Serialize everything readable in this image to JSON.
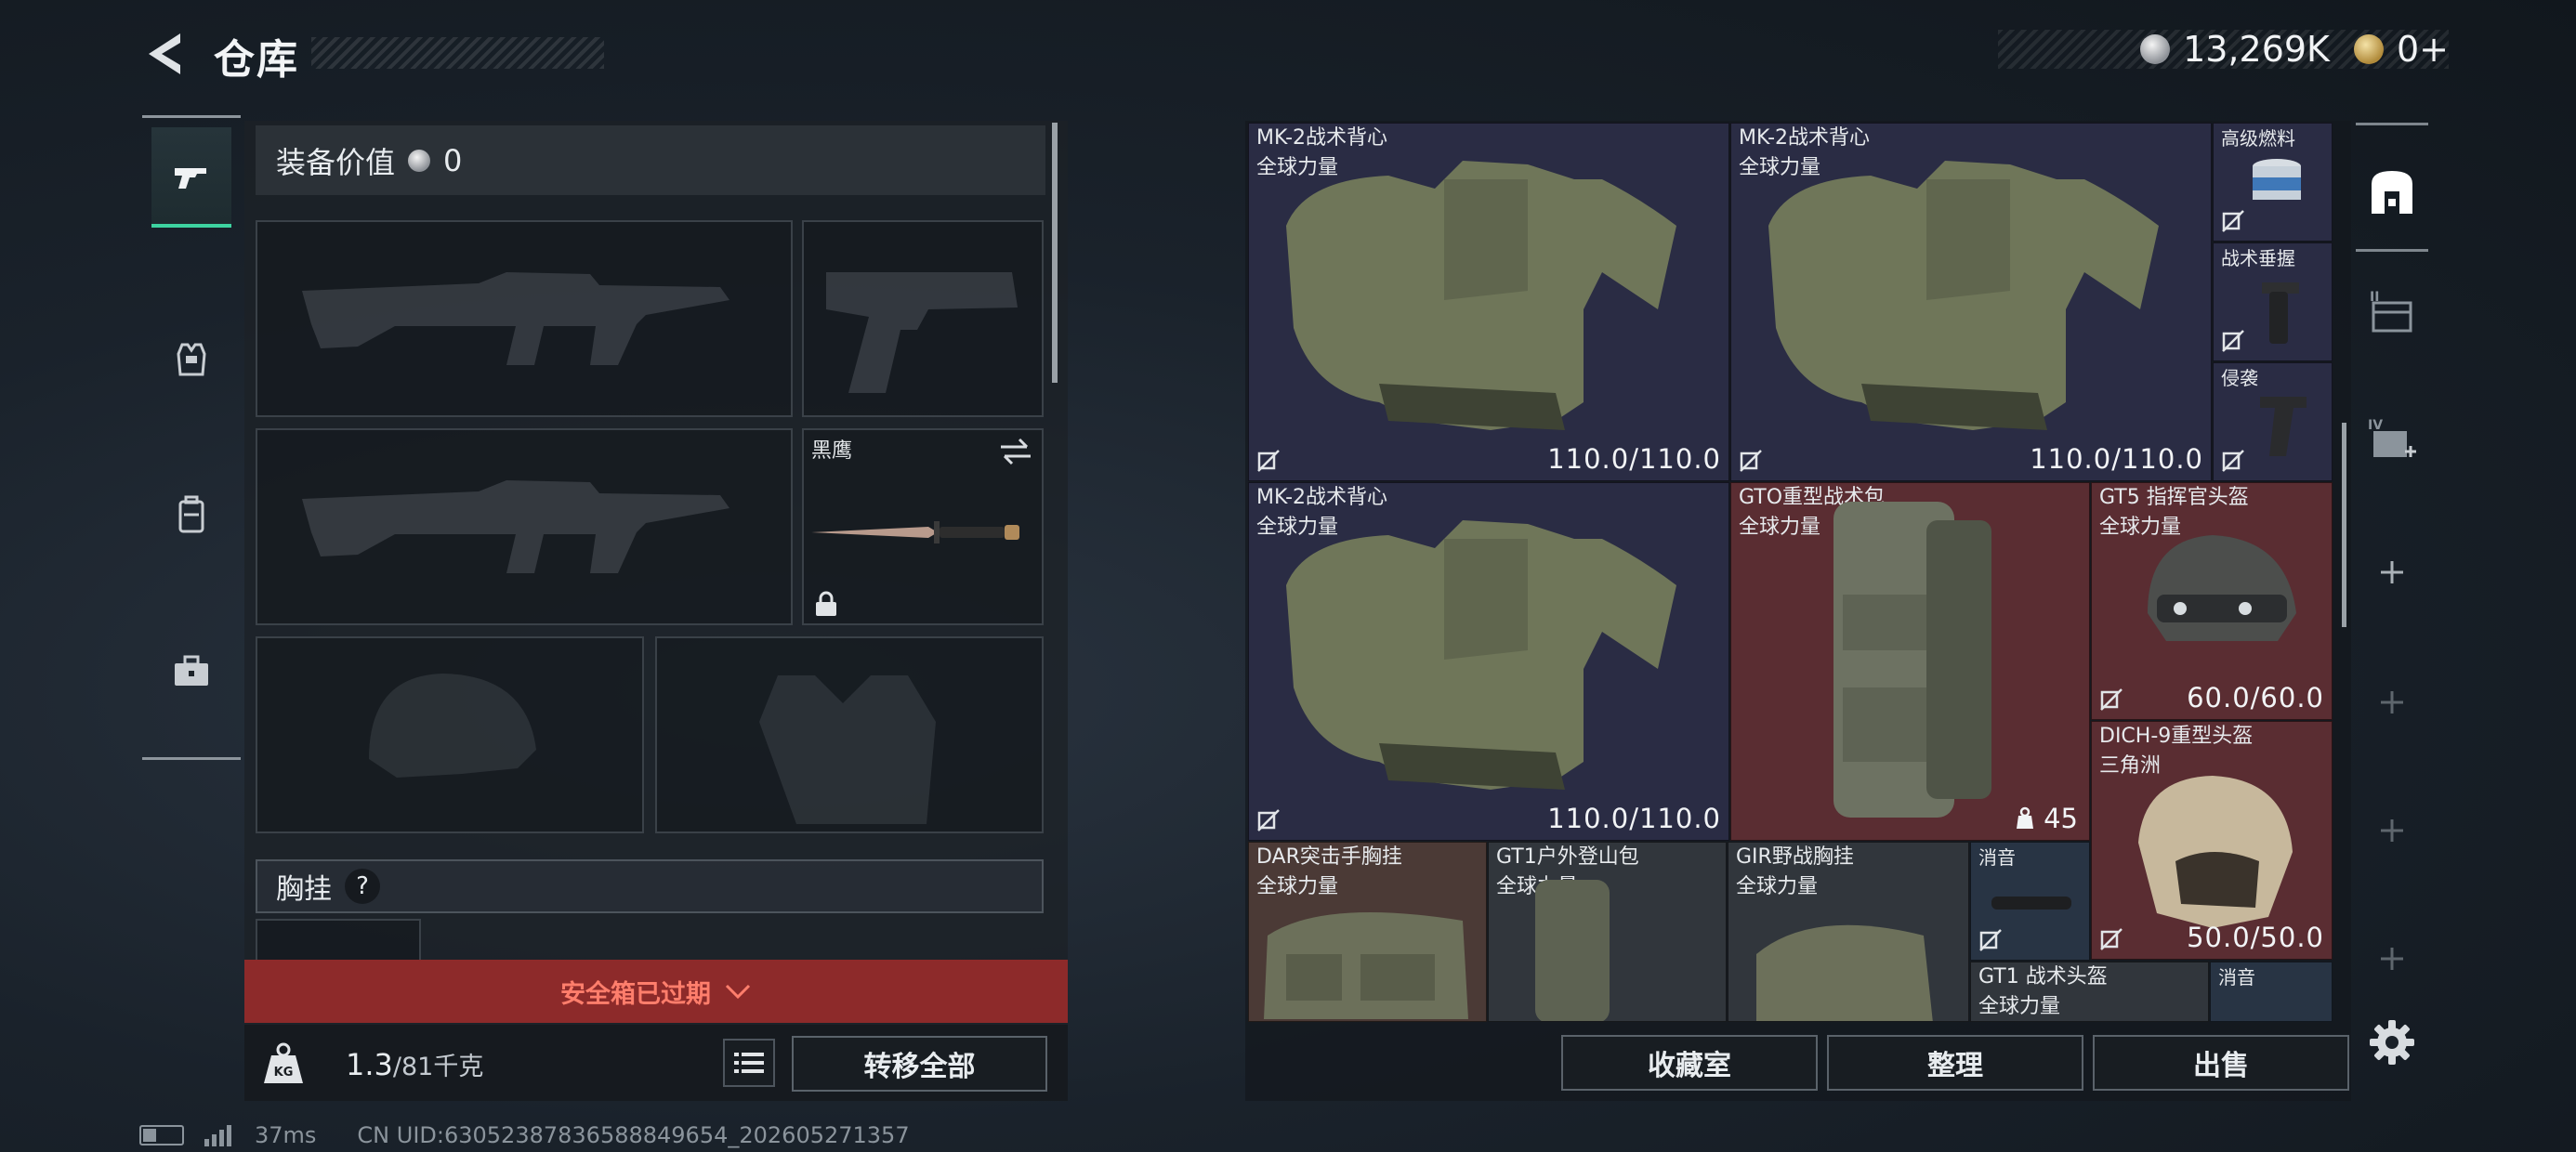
{
  "header": {
    "title": "仓库",
    "currency_value": "13,269K",
    "premium_value": "0+"
  },
  "nav": {
    "items": [
      "weapons",
      "armor",
      "backpack",
      "case"
    ]
  },
  "loadout": {
    "equip_value_label": "装备价值",
    "equip_value": "0",
    "knife_name": "黑鹰",
    "chest_rig_label": "胸挂",
    "help_glyph": "?",
    "alert": "安全箱已过期",
    "weight_current": "1.3",
    "weight_max": "/81千克",
    "transfer_all": "转移全部"
  },
  "status_bar": {
    "ping": "37ms",
    "uid": "CN UID:6305238783658884965­4_202605271357"
  },
  "storage": {
    "items": [
      {
        "name": "MK-2战术背心",
        "sub": "全球力量",
        "durability": "110.0/110.0"
      },
      {
        "name": "MK-2战术背心",
        "sub": "全球力量",
        "durability": "110.0/110.0"
      },
      {
        "name": "高级燃料",
        "sub": ""
      },
      {
        "name": "战术垂握",
        "sub": ""
      },
      {
        "name": "侵袭",
        "sub": ""
      },
      {
        "name": "MK-2战术背心",
        "sub": "全球力量",
        "durability": "110.0/110.0"
      },
      {
        "name": "GTO重型战术包",
        "sub": "全球力量",
        "count": "45"
      },
      {
        "name": "GT5 指挥官头盔",
        "sub": "全球力量",
        "durability": "60.0/60.0"
      },
      {
        "name": "DICH-9重型头盔",
        "sub": "三角洲",
        "durability": "50.0/50.0"
      },
      {
        "name": "DAR突击手胸挂",
        "sub": "全球力量"
      },
      {
        "name": "GT1户外登山包",
        "sub": "全球力量"
      },
      {
        "name": "GIR野战胸挂",
        "sub": "全球力量"
      },
      {
        "name": "消音",
        "sub": ""
      },
      {
        "name": "GT1 战术头盔",
        "sub": "全球力量"
      },
      {
        "name": "消音",
        "sub": ""
      }
    ]
  },
  "buttons": {
    "collection": "收藏室",
    "sort": "整理",
    "sell": "出售"
  },
  "colors": {
    "accent_green": "#3dd3a0",
    "alert_red": "#8d2a2a",
    "cell_navy": "#2a2c44",
    "cell_red": "#5a2d32"
  }
}
